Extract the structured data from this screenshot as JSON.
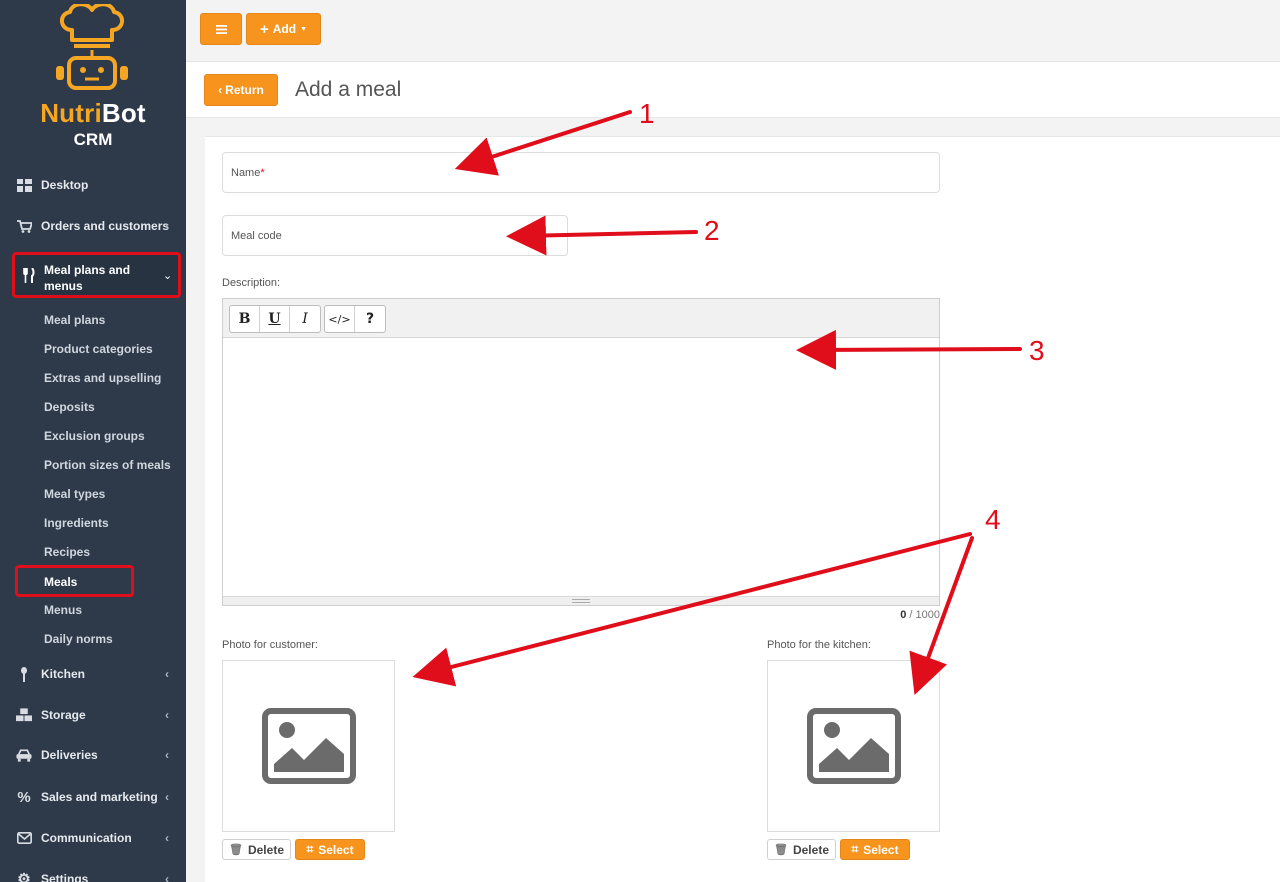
{
  "brand": {
    "name_part1": "Nutri",
    "name_part2": "Bot",
    "sub": "CRM"
  },
  "sidebar": {
    "items": [
      {
        "label": "Desktop",
        "icon": "dashboard-icon"
      },
      {
        "label": "Orders and customers",
        "icon": "cart-icon"
      },
      {
        "label": "Meal plans and menus",
        "icon": "utensils-icon"
      },
      {
        "label": "Kitchen",
        "icon": "spoon-icon"
      },
      {
        "label": "Storage",
        "icon": "cubes-icon"
      },
      {
        "label": "Deliveries",
        "icon": "car-icon"
      },
      {
        "label": "Sales and marketing",
        "icon": "percent-icon"
      },
      {
        "label": "Communication",
        "icon": "envelope-icon"
      },
      {
        "label": "Settings",
        "icon": "gear-icon"
      }
    ],
    "subitems": [
      "Meal plans",
      "Product categories",
      "Extras and upselling",
      "Deposits",
      "Exclusion groups",
      "Portion sizes of meals",
      "Meal types",
      "Ingredients",
      "Recipes",
      "Meals",
      "Menus",
      "Daily norms"
    ]
  },
  "topbar": {
    "add_label": "Add"
  },
  "header": {
    "return_label": "Return",
    "title": "Add a meal"
  },
  "form": {
    "name_label": "Name",
    "name_required": "*",
    "meal_code_label": "Meal code",
    "description_label": "Description:",
    "toolbar": {
      "bold": "B",
      "underline": "U",
      "italic": "I",
      "code": "</>",
      "help": "?"
    },
    "counter_current": "0",
    "counter_sep": " / 1000",
    "photo_customer_label": "Photo for customer:",
    "photo_kitchen_label": "Photo for the kitchen:",
    "delete_label": "Delete",
    "select_label": "Select"
  },
  "annotations": [
    "1",
    "2",
    "3",
    "4"
  ],
  "colors": {
    "accent": "#f7941d",
    "sidebar": "#2e3a4a",
    "highlight": "#e00d1a"
  }
}
